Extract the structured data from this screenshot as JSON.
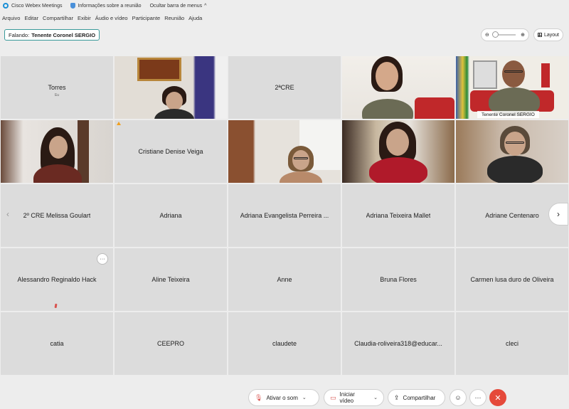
{
  "titlebar": {
    "app_name": "Cisco Webex Meetings",
    "meeting_info": "Informações sobre a reunião",
    "hide_menu": "Ocultar barra de menus"
  },
  "menu": [
    "Arquivo",
    "Editar",
    "Compartilhar",
    "Exibir",
    "Áudio e vídeo",
    "Participante",
    "Reunião",
    "Ajuda"
  ],
  "speaking": {
    "prefix": "Falando:",
    "name": "Tenente Coronel SERGIO"
  },
  "layout_label": "Layout",
  "tiles": {
    "r1c1_name": "Torres",
    "r1c1_sub": "Eu",
    "r1c3_name": "2ªCRE",
    "r1c5_label": "Tenente Coronel SERGIO",
    "r2c2_name": "Cristiane Denise Veiga",
    "r3": [
      "2º CRE Melissa Goulart",
      "Adriana",
      "Adriana Evangelista Perreira ...",
      "Adriana Teixeira Mallet",
      "Adriane Centenaro"
    ],
    "r4": [
      "Alessandro Reginaldo Hack",
      "Aline Teixeira",
      "Anne",
      "Bruna Flores",
      "Carmen lusa duro de Oliveira"
    ],
    "r5": [
      "catia",
      "CEEPRO",
      "claudete",
      "Claudia-roliveira318@educar...",
      "cleci"
    ]
  },
  "controls": {
    "mute_label": "Ativar o som",
    "video_label": "Iniciar vídeo",
    "share_label": "Compartilhar"
  },
  "colors": {
    "active_border": "#3ab0c8",
    "leave_button": "#e5493a",
    "tile_bg": "#dcdcdc"
  }
}
